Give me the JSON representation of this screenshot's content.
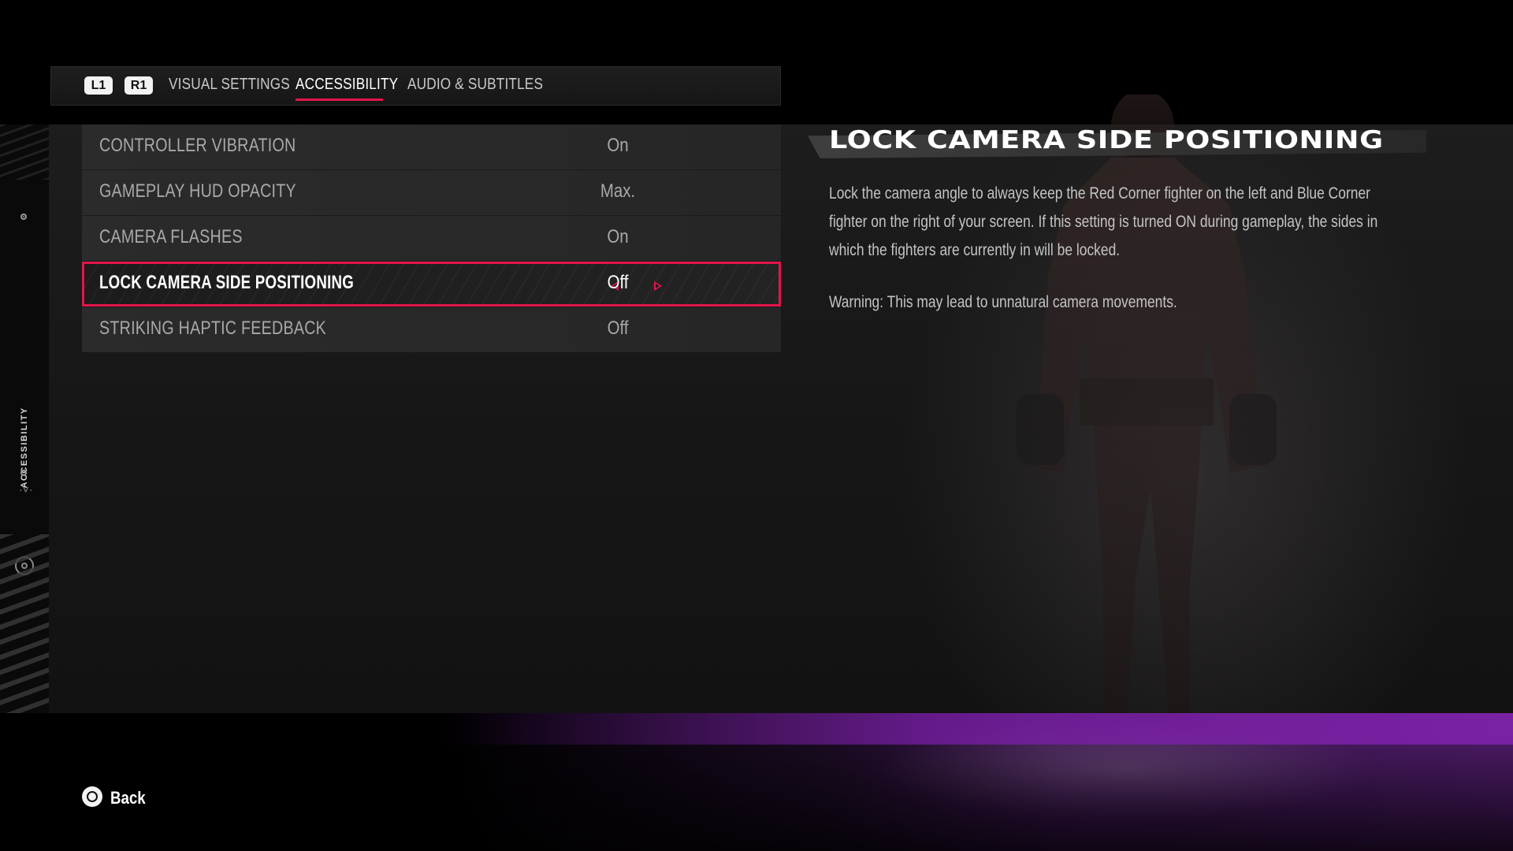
{
  "tabs": {
    "shoulder_left": "L1",
    "shoulder_right": "R1",
    "items": [
      {
        "label": "VISUAL SETTINGS",
        "active": false
      },
      {
        "label": "ACCESSIBILITY",
        "active": true
      },
      {
        "label": "AUDIO & SUBTITLES",
        "active": false
      }
    ]
  },
  "sidebar": {
    "section_label": "ACCESSIBILITY",
    "icons": [
      "dot-icon",
      "target-icon",
      "dot-icon",
      "chevron-down-icon"
    ]
  },
  "settings": [
    {
      "label": "CONTROLLER VIBRATION",
      "value": "On",
      "selected": false
    },
    {
      "label": "GAMEPLAY HUD OPACITY",
      "value": "Max.",
      "selected": false
    },
    {
      "label": "CAMERA FLASHES",
      "value": "On",
      "selected": false
    },
    {
      "label": "LOCK CAMERA SIDE POSITIONING",
      "value": "Off",
      "selected": true
    },
    {
      "label": "STRIKING HAPTIC FEEDBACK",
      "value": "Off",
      "selected": false
    }
  ],
  "description": {
    "title": "LOCK CAMERA SIDE POSITIONING",
    "body": "Lock the camera angle to always keep the Red Corner fighter on the left and Blue Corner fighter on the right of your screen. If this setting is turned ON during gameplay, the sides in which the fighters are currently in will be locked.",
    "warning": "Warning: This may lead to unnatural camera movements."
  },
  "footer": {
    "back_label": "Back",
    "back_icon": "circle-button-icon"
  },
  "colors": {
    "accent": "#e3154c",
    "floor_purple": "#4a1a63"
  }
}
